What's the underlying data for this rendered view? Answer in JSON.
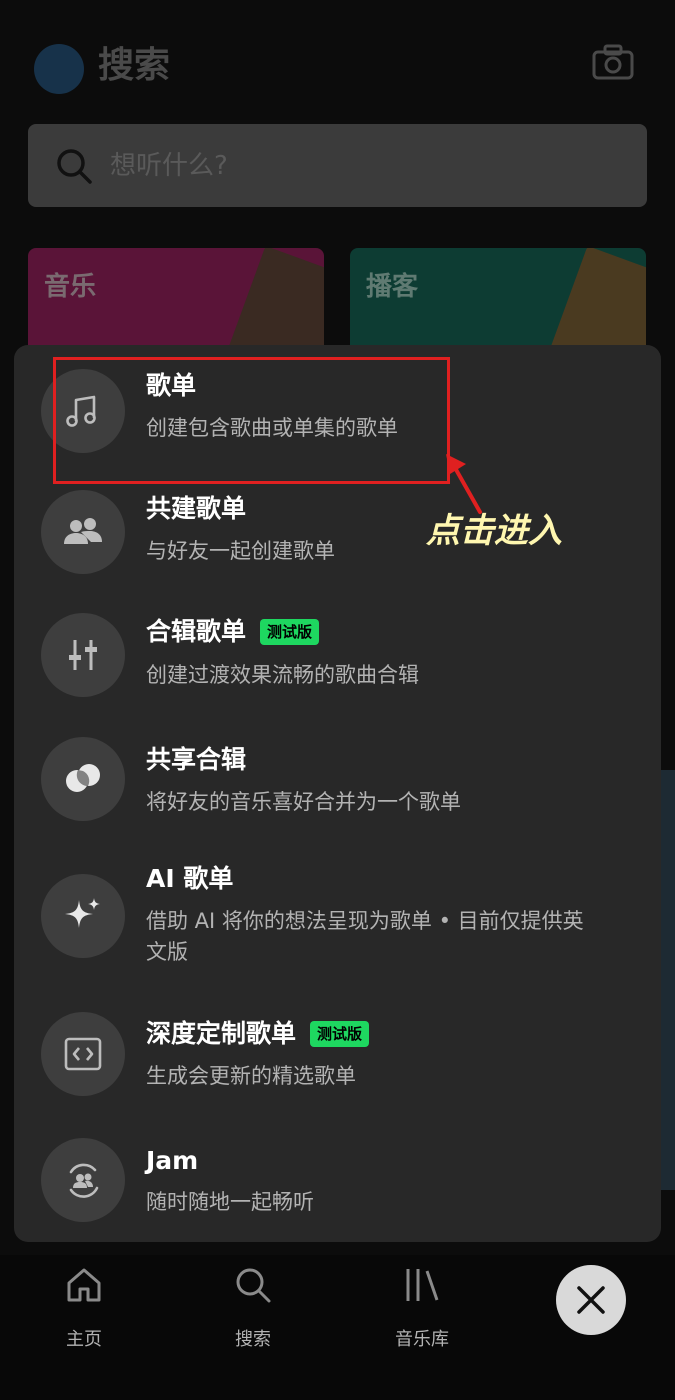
{
  "header": {
    "title": "搜索"
  },
  "search": {
    "placeholder": "想听什么?"
  },
  "categories": [
    {
      "label": "音乐"
    },
    {
      "label": "播客"
    }
  ],
  "sheet": {
    "items": [
      {
        "title": "歌单",
        "desc": "创建包含歌曲或单集的歌单",
        "icon": "music-note-icon"
      },
      {
        "title": "共建歌单",
        "desc": "与好友一起创建歌单",
        "icon": "people-icon"
      },
      {
        "title": "合辑歌单",
        "badge": "测试版",
        "desc": "创建过渡效果流畅的歌曲合辑",
        "icon": "sliders-icon"
      },
      {
        "title": "共享合辑",
        "desc": "将好友的音乐喜好合并为一个歌单",
        "icon": "blend-icon"
      },
      {
        "title": "AI 歌单",
        "desc": "借助 AI 将你的想法呈现为歌单 • 目前仅提供英文版",
        "icon": "sparkle-icon"
      },
      {
        "title": "深度定制歌单",
        "badge": "测试版",
        "desc": "生成会更新的精选歌单",
        "icon": "code-icon"
      },
      {
        "title": "Jam",
        "desc": "随时随地一起畅听",
        "icon": "jam-icon"
      }
    ]
  },
  "annotation": {
    "text": "点击进入",
    "color": "#e02020"
  },
  "nav": {
    "items": [
      {
        "label": "主页",
        "icon": "home-icon"
      },
      {
        "label": "搜索",
        "icon": "search-icon"
      },
      {
        "label": "音乐库",
        "icon": "library-icon"
      }
    ]
  },
  "colors": {
    "accent": "#1ed760",
    "sheet_bg": "#282828"
  }
}
